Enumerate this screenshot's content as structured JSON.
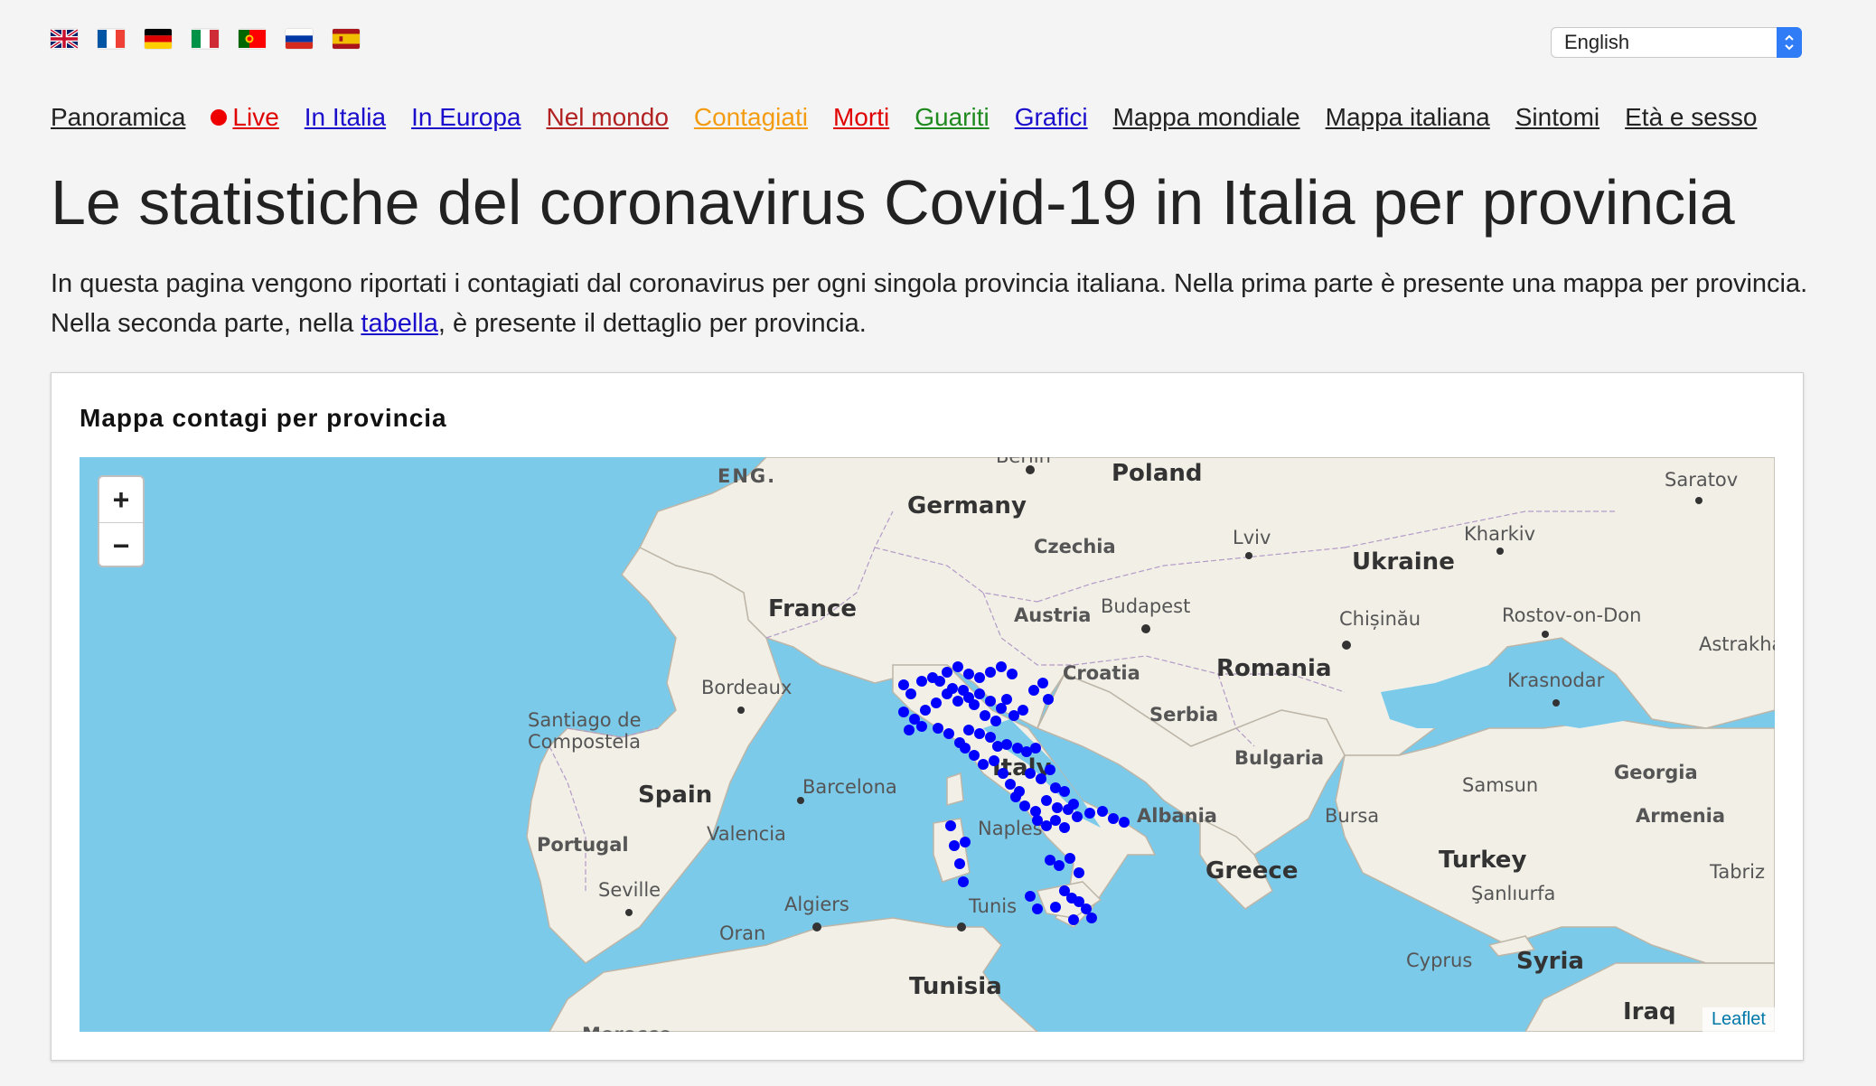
{
  "flags": [
    {
      "name": "uk-flag"
    },
    {
      "name": "france-flag"
    },
    {
      "name": "germany-flag"
    },
    {
      "name": "italy-flag"
    },
    {
      "name": "portugal-flag"
    },
    {
      "name": "russia-flag"
    },
    {
      "name": "spain-flag"
    }
  ],
  "language_select": {
    "value": "English",
    "icon": "select-arrows-icon"
  },
  "nav": [
    {
      "label": "Panoramica",
      "color": "#222222"
    },
    {
      "label": "Live",
      "color": "#e00000"
    },
    {
      "label": "In Italia",
      "color": "#1a0dcc"
    },
    {
      "label": "In Europa",
      "color": "#1a0dcc"
    },
    {
      "label": "Nel mondo",
      "color": "#b22222"
    },
    {
      "label": "Contagiati",
      "color": "#f39c12"
    },
    {
      "label": "Morti",
      "color": "#e00000"
    },
    {
      "label": "Guariti",
      "color": "#1e8a1e"
    },
    {
      "label": "Grafici",
      "color": "#1a0dcc"
    },
    {
      "label": "Mappa mondiale",
      "color": "#222222"
    },
    {
      "label": "Mappa italiana",
      "color": "#222222"
    },
    {
      "label": "Sintomi",
      "color": "#222222"
    },
    {
      "label": "Età e sesso",
      "color": "#222222"
    }
  ],
  "page_title": "Le statistiche del coronavirus Covid-19 in Italia per provincia",
  "intro": {
    "text_before": "In questa pagina vengono riportati i contagiati dal coronavirus per ogni singola provincia italiana. Nella prima parte è presente una mappa per provincia. Nella seconda parte, nella ",
    "link": "tabella",
    "text_after": ", è presente il dettaglio per provincia."
  },
  "map_card": {
    "title": "Mappa contagi per provincia",
    "zoom_in": "+",
    "zoom_out": "−",
    "attribution": "Leaflet",
    "marker_color": "#0000ff",
    "labels": {
      "eng": "ENG.",
      "berlin": "Berlin",
      "poland": "Poland",
      "germany": "Germany",
      "czechia": "Czechia",
      "lviv": "Lviv",
      "ukraine": "Ukraine",
      "kharkiv": "Kharkiv",
      "saratov": "Saratov",
      "france": "France",
      "austria": "Austria",
      "budapest": "Budapest",
      "chisinau": "Chișinău",
      "rostov": "Rostov-on-Don",
      "astrakhan": "Astrakha",
      "bordeaux": "Bordeaux",
      "croatia": "Croatia",
      "romania": "Romania",
      "krasnodar": "Krasnodar",
      "santiago_1": "Santiago de",
      "santiago_2": "Compostela",
      "serbia": "Serbia",
      "italy": "Italy",
      "bulgaria": "Bulgaria",
      "georgia": "Georgia",
      "spain": "Spain",
      "barcelona": "Barcelona",
      "samsun": "Samsun",
      "albania": "Albania",
      "bursa": "Bursa",
      "armenia": "Armenia",
      "portugal": "Portugal",
      "valencia": "Valencia",
      "naples": "Naples",
      "greece": "Greece",
      "turkey": "Turkey",
      "tabriz": "Tabriz",
      "seville": "Seville",
      "algiers": "Algiers",
      "tunis": "Tunis",
      "sanliurfa": "Şanlıurfa",
      "oran": "Oran",
      "cyprus": "Cyprus",
      "syria": "Syria",
      "tunisia": "Tunisia",
      "iraq": "Iraq",
      "morocco": "Morocco"
    }
  }
}
